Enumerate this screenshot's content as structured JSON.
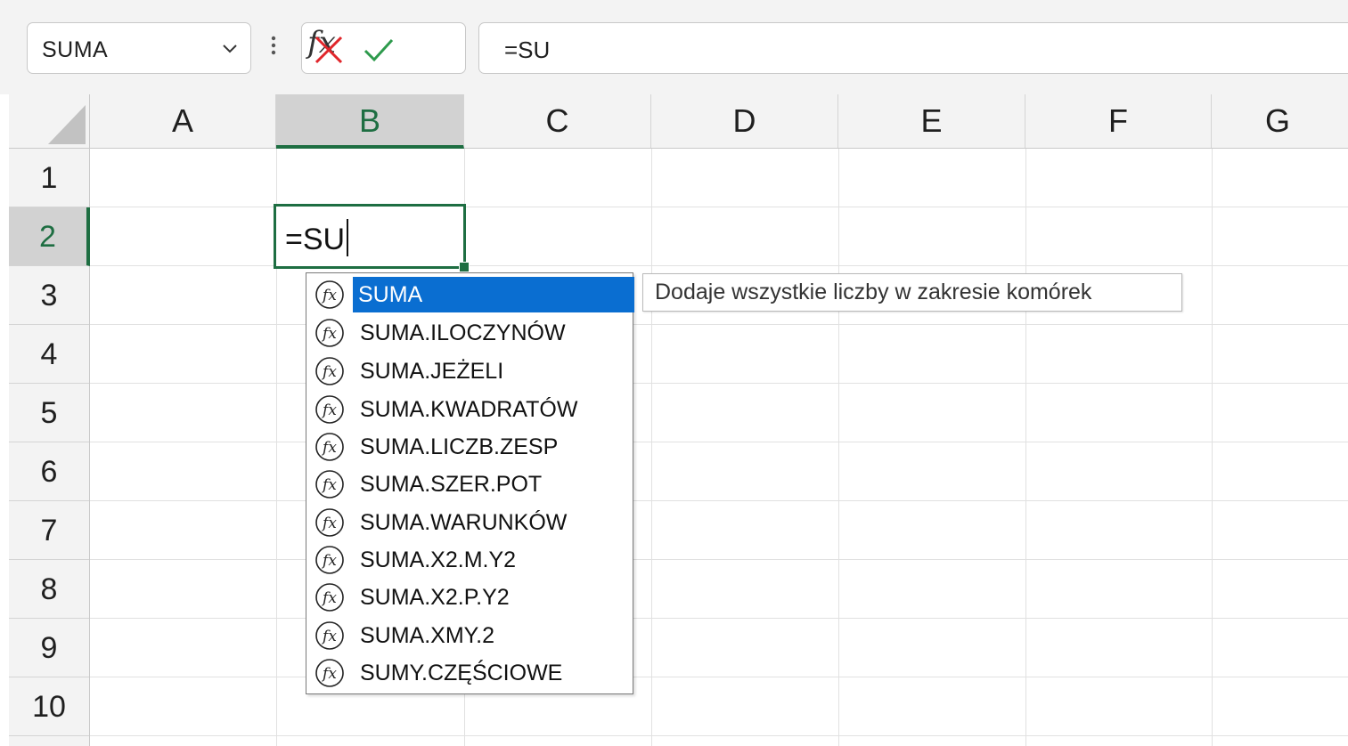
{
  "name_box": {
    "value": "SUMA"
  },
  "formula_bar": {
    "more_glyph": "⋮",
    "fx_label": "fx",
    "formula_text": "=SU"
  },
  "columns": [
    "A",
    "B",
    "C",
    "D",
    "E",
    "F",
    "G"
  ],
  "active_column": "B",
  "rows": [
    "1",
    "2",
    "3",
    "4",
    "5",
    "6",
    "7",
    "8",
    "9",
    "10"
  ],
  "active_row": "2",
  "active_cell": {
    "address": "B2",
    "text": "=SU"
  },
  "autocomplete": {
    "items": [
      "SUMA",
      "SUMA.ILOCZYNÓW",
      "SUMA.JEŻELI",
      "SUMA.KWADRATÓW",
      "SUMA.LICZB.ZESP",
      "SUMA.SZER.POT",
      "SUMA.WARUNKÓW",
      "SUMA.X2.M.Y2",
      "SUMA.X2.P.Y2",
      "SUMA.XMY.2",
      "SUMY.CZĘŚCIOWE"
    ],
    "selected_index": 0,
    "tooltip": "Dodaje wszystkie liczby w zakresie komórek"
  },
  "colors": {
    "accent_green": "#1e6e42",
    "selection_blue": "#0a6ed1",
    "cancel_red": "#e0262b",
    "enter_green": "#2d9a4c"
  },
  "icons": {
    "name_box_dropdown": "chevron-down-icon",
    "cancel": "close-icon",
    "enter": "checkmark-icon",
    "function": "function-icon",
    "select_all": "select-all-triangle-icon"
  }
}
